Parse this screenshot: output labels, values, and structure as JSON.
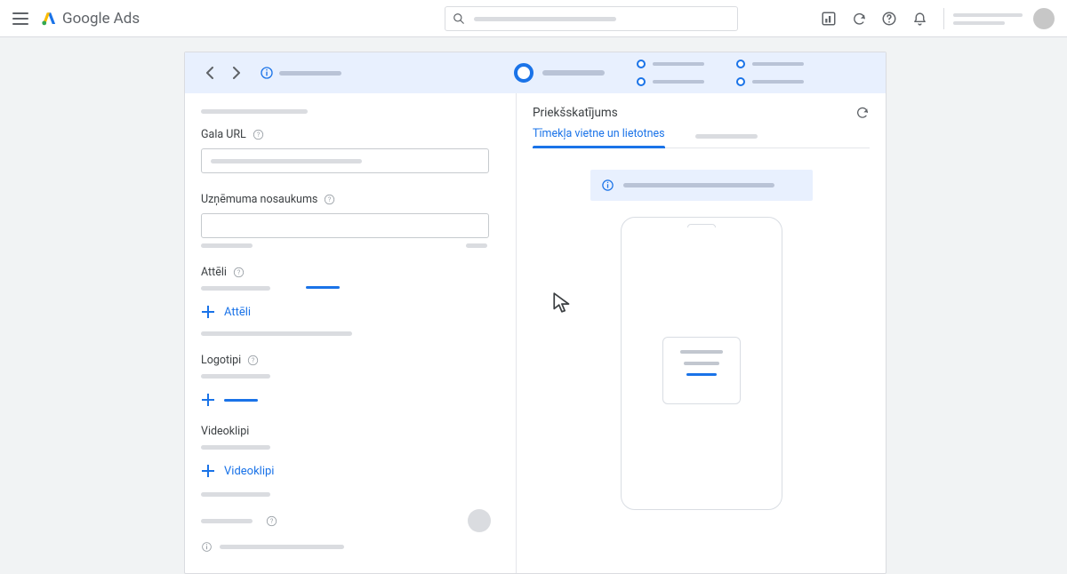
{
  "brand": {
    "google": "Google",
    "ads": "Ads"
  },
  "form": {
    "final_url_label": "Gala URL",
    "business_name_label": "Uzņēmuma nosaukums",
    "images_label": "Attēli",
    "add_images": "Attēli",
    "logos_label": "Logotipi",
    "videos_label": "Videoklipi",
    "add_videos": "Videoklipi"
  },
  "preview": {
    "title": "Priekšskatījums",
    "tab_web_apps": "Tīmekļa vietne un lietotnes"
  }
}
